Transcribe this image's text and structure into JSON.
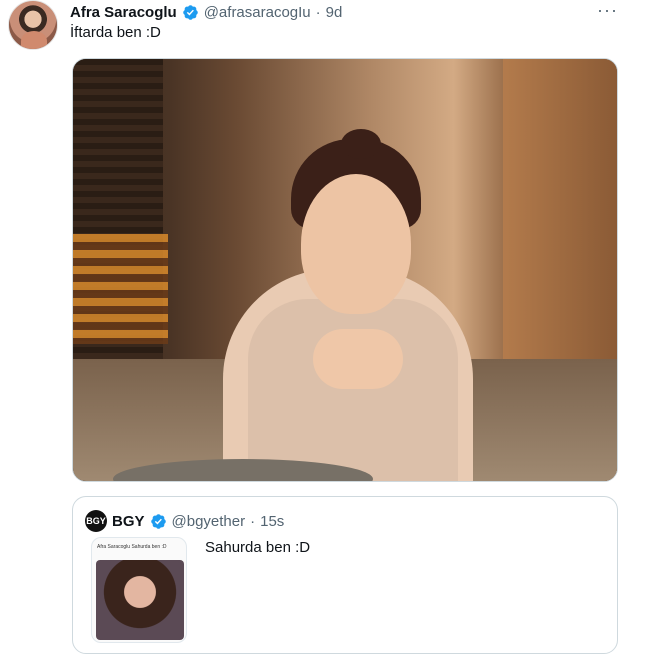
{
  "tweet": {
    "author_name": "Afra Saracoglu",
    "author_handle": "@afrasaracogIu",
    "dot": "·",
    "time": "9d",
    "more_label": "···",
    "text": "İftarda ben :D"
  },
  "quote": {
    "avatar_text": "BGY",
    "author_name": "BGY",
    "author_handle": "@bgyether",
    "dot": "·",
    "time": "15s",
    "text": "Sahurda ben :D",
    "thumb_header": "Afra Saracoglu\nSahurda ben :D"
  },
  "colors": {
    "verified": "#1d9bf0",
    "secondary_text": "#536471"
  }
}
